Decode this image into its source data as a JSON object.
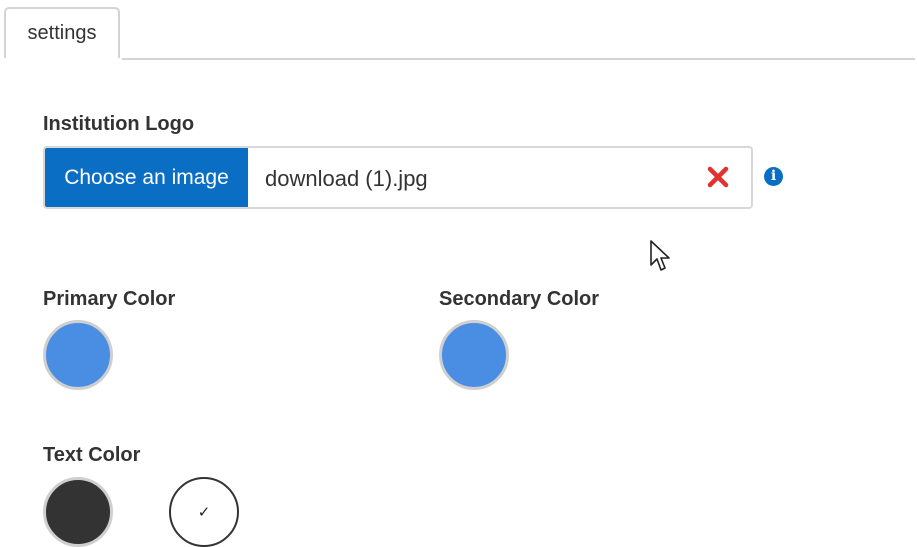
{
  "tabs": [
    {
      "label": "settings",
      "active": true
    }
  ],
  "institution_logo": {
    "label": "Institution Logo",
    "choose_button_label": "Choose an image",
    "file_name": "download (1).jpg",
    "clear_icon": "close-icon",
    "info_icon": "info-icon"
  },
  "primary_color": {
    "label": "Primary Color",
    "value": "#4a8ee3"
  },
  "secondary_color": {
    "label": "Secondary Color",
    "value": "#4a8ee3"
  },
  "text_color": {
    "label": "Text Color",
    "options": [
      {
        "value": "#333333",
        "selected": false
      },
      {
        "value": "#ffffff",
        "selected": true
      }
    ],
    "check_glyph": "✓"
  },
  "colors": {
    "accent": "#0a6fc4",
    "clear_icon": "#e0322e"
  }
}
